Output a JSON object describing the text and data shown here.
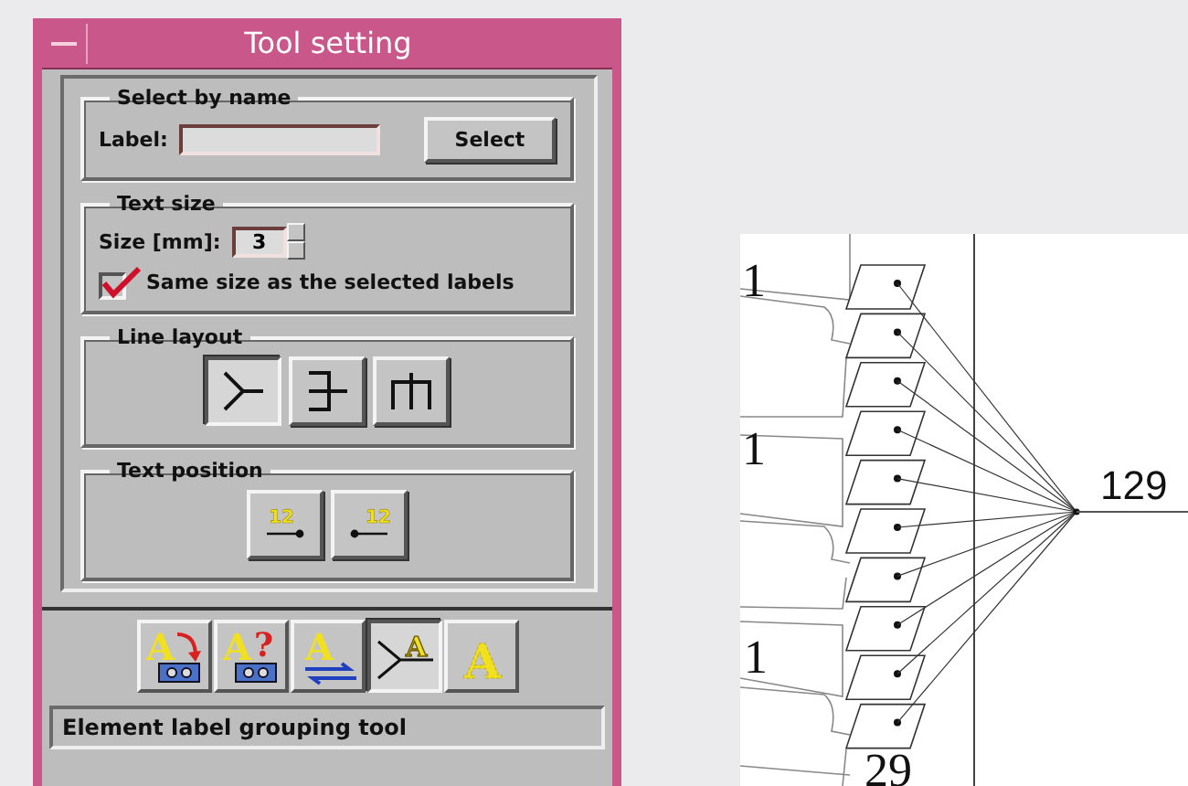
{
  "window": {
    "title": "Tool setting"
  },
  "select_by_name": {
    "title": "Select by name",
    "label": "Label:",
    "button": "Select"
  },
  "text_size": {
    "title": "Text size",
    "label": "Size [mm]:",
    "value": "3",
    "same_size": {
      "label": "Same size as the selected labels",
      "checked": true
    }
  },
  "line_layout": {
    "title": "Line layout",
    "options": [
      {
        "kind": "fan",
        "selected": true
      },
      {
        "kind": "bracket",
        "selected": false
      },
      {
        "kind": "comb",
        "selected": false
      }
    ]
  },
  "text_position": {
    "title": "Text position",
    "options": [
      {
        "kind": "left",
        "text": "12",
        "selected": false
      },
      {
        "kind": "right",
        "text": "12",
        "selected": false
      }
    ]
  },
  "toolbar": [
    {
      "kind": "move",
      "letter": "A",
      "selected": false
    },
    {
      "kind": "query",
      "letter": "A",
      "mark": "?",
      "selected": false
    },
    {
      "kind": "swap",
      "letter": "A",
      "selected": false
    },
    {
      "kind": "group",
      "letter": "A",
      "selected": true
    },
    {
      "kind": "style",
      "letter": "A",
      "selected": false
    }
  ],
  "status_bar": "Element label grouping tool",
  "canvas": {
    "labels": [
      {
        "text": "1"
      },
      {
        "text": "1"
      },
      {
        "text": "1"
      },
      {
        "text": "29"
      }
    ],
    "node_label": "129"
  }
}
